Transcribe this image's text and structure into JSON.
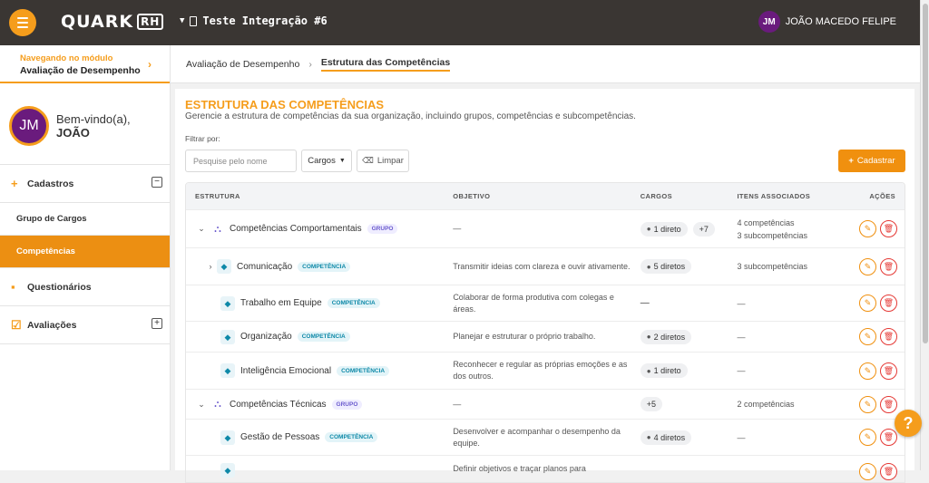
{
  "header": {
    "logo": "QUARK",
    "logo_suffix": "RH",
    "org": "Teste Integração #6",
    "user_initials": "JM",
    "user_name": "JOÃO MACEDO FELIPE"
  },
  "sidebar": {
    "nav_label": "Navegando no módulo",
    "nav_module": "Avaliação de Desempenho",
    "welcome": "Bem-vindo(a),",
    "welcome_name": "JOÃO",
    "avatar": "JM",
    "sections": [
      {
        "label": "Cadastros",
        "icon": "plus-icon",
        "toggle": "−"
      },
      {
        "label": "Questionários",
        "icon": "clipboard-icon"
      },
      {
        "label": "Avaliações",
        "icon": "checkbox-icon",
        "toggle": "+"
      }
    ],
    "items": [
      {
        "label": "Grupo de Cargos"
      },
      {
        "label": "Competências"
      }
    ]
  },
  "breadcrumb": {
    "parent": "Avaliação de Desempenho",
    "current": "Estrutura das Competências"
  },
  "page": {
    "title": "ESTRUTURA DAS COMPETÊNCIAS",
    "subtitle": "Gerencie a estrutura de competências da sua organização, incluindo grupos, competências e subcompetências.",
    "filter_label": "Filtrar por:",
    "search_placeholder": "Pesquise pelo nome",
    "select": "Cargos",
    "clear": "Limpar",
    "create": "Cadastrar"
  },
  "table": {
    "headers": [
      "ESTRUTURA",
      "OBJETIVO",
      "CARGOS",
      "ITENS ASSOCIADOS",
      "AÇÕES"
    ],
    "rows": [
      {
        "name": "Competências Comportamentais",
        "tag": "GRUPO",
        "objective": "—",
        "cargos": "1 direto",
        "extra": "+7",
        "items": "4 competências",
        "items2": "3 subcompetências"
      },
      {
        "name": "Comunicação",
        "tag": "COMPETÊNCIA",
        "objective": "Transmitir ideias com clareza e ouvir ativamente.",
        "cargos": "5 diretos",
        "extra": "",
        "items": "3 subcompetências",
        "items2": ""
      },
      {
        "name": "Trabalho em Equipe",
        "tag": "COMPETÊNCIA",
        "objective": "Colaborar de forma produtiva com colegas e áreas.",
        "cargos": "—",
        "extra": "",
        "items": "—",
        "items2": ""
      },
      {
        "name": "Organização",
        "tag": "COMPETÊNCIA",
        "objective": "Planejar e estruturar o próprio trabalho.",
        "cargos": "2 diretos",
        "extra": "",
        "items": "—",
        "items2": ""
      },
      {
        "name": "Inteligência Emocional",
        "tag": "COMPETÊNCIA",
        "objective": "Reconhecer e regular as próprias emoções e as dos outros.",
        "cargos": "1 direto",
        "extra": "",
        "items": "—",
        "items2": ""
      },
      {
        "name": "Competências Técnicas",
        "tag": "GRUPO",
        "objective": "—",
        "cargos": "",
        "extra": "+5",
        "items": "2 competências",
        "items2": ""
      },
      {
        "name": "Gestão de Pessoas",
        "tag": "COMPETÊNCIA",
        "objective": "Desenvolver e acompanhar o desempenho da equipe.",
        "cargos": "4 diretos",
        "extra": "",
        "items": "—",
        "items2": ""
      },
      {
        "name": "",
        "tag": "",
        "objective": "Definir objetivos e traçar planos para",
        "cargos": "",
        "extra": "",
        "items": "",
        "items2": ""
      }
    ]
  },
  "help": "?"
}
